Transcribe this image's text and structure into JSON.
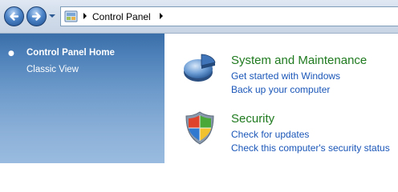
{
  "address_bar": {
    "location": "Control Panel"
  },
  "left_pane": {
    "items": [
      {
        "label": "Control Panel Home",
        "selected": true
      },
      {
        "label": "Classic View",
        "selected": false
      }
    ]
  },
  "categories": [
    {
      "title": "System and Maintenance",
      "icon": "system-maintenance-icon",
      "links": [
        "Get started with Windows",
        "Back up your computer"
      ]
    },
    {
      "title": "Security",
      "icon": "security-shield-icon",
      "links": [
        "Check for updates",
        "Check this computer's security status"
      ]
    }
  ],
  "colors": {
    "category_title": "#1f7a1f",
    "link": "#1a56b8",
    "left_pane_top": "#3a6ea8",
    "left_pane_bottom": "#99bbdf"
  }
}
